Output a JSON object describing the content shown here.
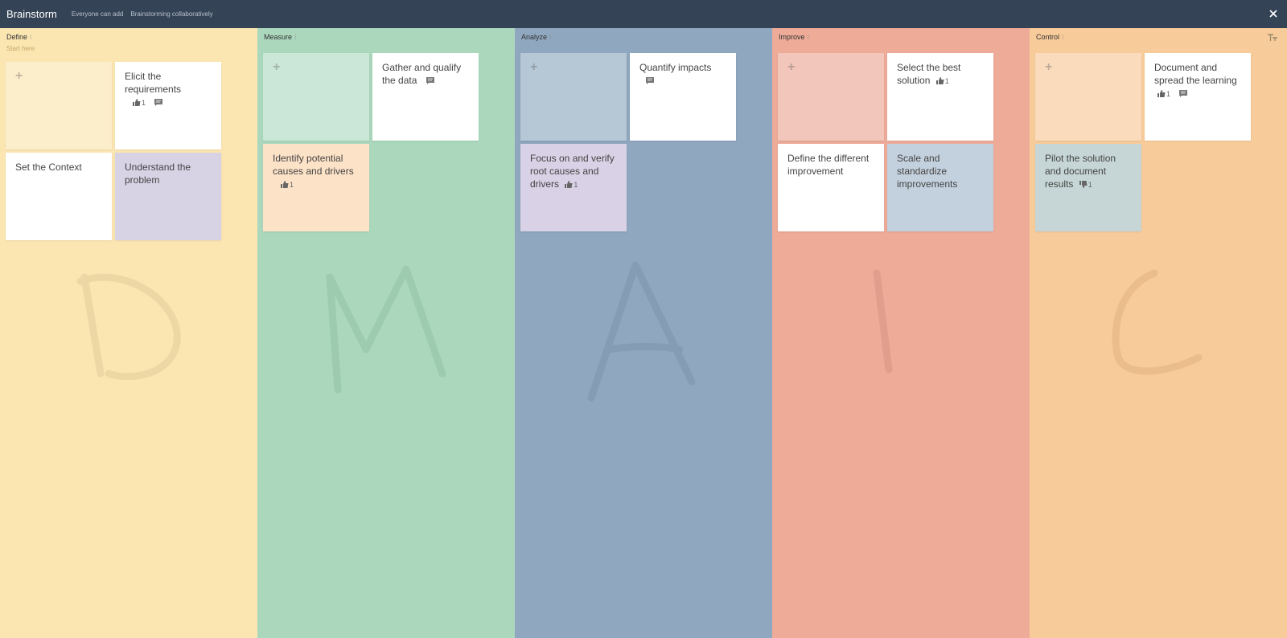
{
  "header": {
    "title": "Brainstorm",
    "subtitle_1": "Everyone can add",
    "subtitle_2": "Brainstorming collaboratively"
  },
  "columns": [
    {
      "name": "Define",
      "subtitle": "Start here",
      "letter": "D",
      "cards": [
        {
          "text": "Elicit the requirements",
          "likes": "1",
          "has_comment": true
        },
        {
          "text": "Set the Context"
        },
        {
          "text": "Understand the problem"
        }
      ]
    },
    {
      "name": "Measure",
      "letter": "M",
      "cards": [
        {
          "text": "Gather and qualify the data",
          "has_comment": true
        },
        {
          "text": "Identify potential causes and drivers",
          "likes": "1"
        }
      ]
    },
    {
      "name": "Analyze",
      "letter": "A",
      "cards": [
        {
          "text": "Quantify impacts",
          "has_comment": true
        },
        {
          "text": "Focus on and verify root causes and drivers",
          "likes": "1"
        }
      ]
    },
    {
      "name": "Improve",
      "letter": "I",
      "cards": [
        {
          "text": "Select the best solution",
          "likes": "1"
        },
        {
          "text": "Define the different improvement"
        },
        {
          "text": "Scale and standardize improvements"
        }
      ]
    },
    {
      "name": "Control",
      "letter": "C",
      "cards": [
        {
          "text": "Document and spread the learning",
          "likes": "1",
          "has_comment": true
        },
        {
          "text": "Pilot the solution and document results",
          "dislikes": "1"
        }
      ]
    }
  ],
  "colors": {
    "topbar": "#354356",
    "define": "#fbe6b2",
    "measure": "#abd7bd",
    "analyze": "#8fa7bf",
    "improve": "#edab98",
    "control": "#f8cb9a"
  }
}
